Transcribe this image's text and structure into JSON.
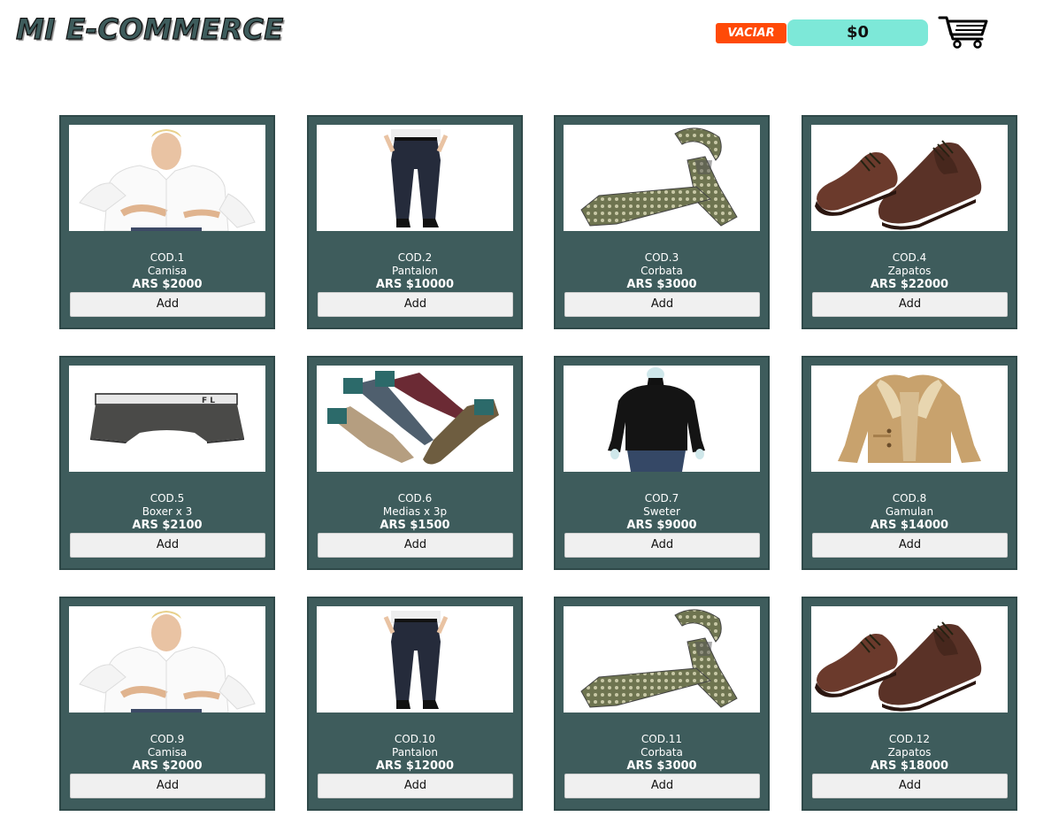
{
  "header": {
    "brand": "MI E-COMMERCE",
    "empty_label": "VACIAR",
    "total": "$0",
    "cart_icon": "shopping-cart-icon"
  },
  "products": [
    {
      "code": "COD.1",
      "name": "Camisa",
      "price": "ARS $2000",
      "image": "shirt",
      "add_label": "Add"
    },
    {
      "code": "COD.2",
      "name": "Pantalon",
      "price": "ARS $10000",
      "image": "pants",
      "add_label": "Add"
    },
    {
      "code": "COD.3",
      "name": "Corbata",
      "price": "ARS $3000",
      "image": "tie",
      "add_label": "Add"
    },
    {
      "code": "COD.4",
      "name": "Zapatos",
      "price": "ARS $22000",
      "image": "shoes",
      "add_label": "Add"
    },
    {
      "code": "COD.5",
      "name": "Boxer x 3",
      "price": "ARS $2100",
      "image": "boxer",
      "add_label": "Add"
    },
    {
      "code": "COD.6",
      "name": "Medias x 3p",
      "price": "ARS $1500",
      "image": "socks",
      "add_label": "Add"
    },
    {
      "code": "COD.7",
      "name": "Sweter",
      "price": "ARS $9000",
      "image": "sweater",
      "add_label": "Add"
    },
    {
      "code": "COD.8",
      "name": "Gamulan",
      "price": "ARS $14000",
      "image": "coat",
      "add_label": "Add"
    },
    {
      "code": "COD.9",
      "name": "Camisa",
      "price": "ARS $2000",
      "image": "shirt",
      "add_label": "Add"
    },
    {
      "code": "COD.10",
      "name": "Pantalon",
      "price": "ARS $12000",
      "image": "pants",
      "add_label": "Add"
    },
    {
      "code": "COD.11",
      "name": "Corbata",
      "price": "ARS $3000",
      "image": "tie",
      "add_label": "Add"
    },
    {
      "code": "COD.12",
      "name": "Zapatos",
      "price": "ARS $18000",
      "image": "shoes",
      "add_label": "Add"
    }
  ],
  "colors": {
    "card_bg": "#3e5c5c",
    "empty_button": "#ff4a08",
    "total_box": "#7de8d8"
  }
}
